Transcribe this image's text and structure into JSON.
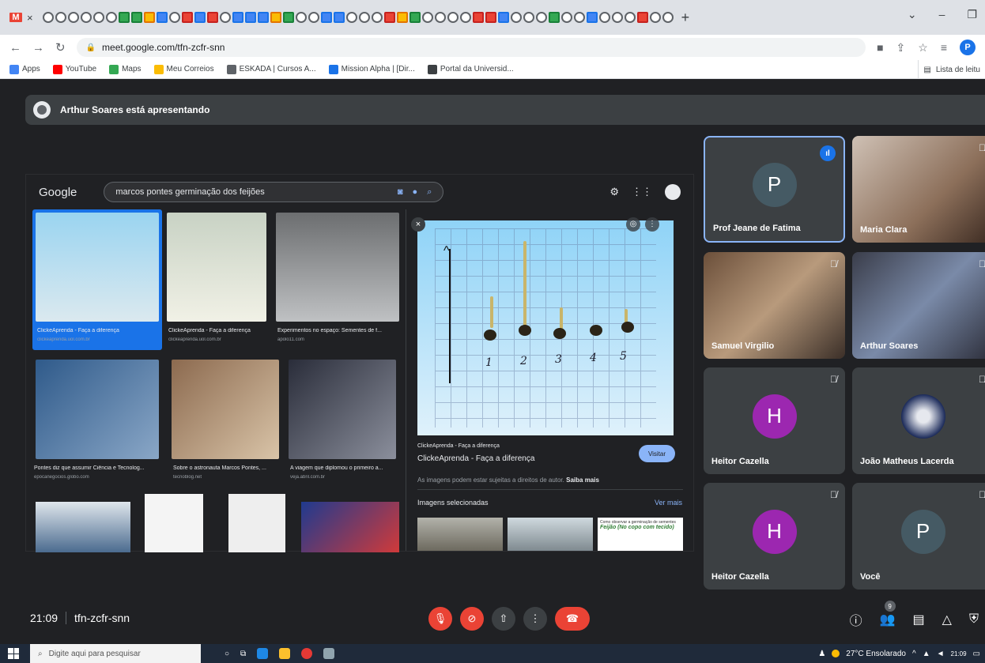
{
  "browser": {
    "url": "meet.google.com/tfn-zcfr-snn",
    "new_tab": "+",
    "bookmarks": [
      {
        "label": "Apps",
        "color": "#4285f4"
      },
      {
        "label": "YouTube",
        "color": "#ff0000"
      },
      {
        "label": "Maps",
        "color": "#34a853"
      },
      {
        "label": "Meu Correios",
        "color": "#fbbc04"
      },
      {
        "label": "ESKADA | Cursos A...",
        "color": "#5f6368"
      },
      {
        "label": "Mission Alpha | [Dir...",
        "color": "#1a73e8"
      },
      {
        "label": "Portal da Universid...",
        "color": "#3c4043"
      }
    ],
    "reading_list": "Lista de leitu"
  },
  "meet": {
    "presenter_banner": "Arthur Soares está apresentando",
    "time": "21:09",
    "meeting_code": "tfn-zcfr-snn",
    "participants_count": "9"
  },
  "shared_screen": {
    "search_query": "marcos pontes germinação dos feijões",
    "logo": "Google",
    "results": [
      {
        "caption": "ClickeAprenda - Faça a diferença",
        "source": "clickeaprenda.uol.com.br"
      },
      {
        "caption": "ClickeAprenda - Faça a diferença",
        "source": "clickeaprenda.uol.com.br"
      },
      {
        "caption": "Experimentos no espaço: Sementes de f...",
        "source": "apolo11.com"
      },
      {
        "caption": "Pontes diz que assumir Ciência e Tecnolog...",
        "source": "epocanegocios.globo.com"
      },
      {
        "caption": "Sobre o astronauta Marcos Pontes, ...",
        "source": "tecnoblog.net"
      },
      {
        "caption": "A viagem que diplomou o primeiro a...",
        "source": "veja.abril.com.br"
      }
    ],
    "preview": {
      "site": "ClickeAprenda - Faça a diferença",
      "title": "ClickeAprenda - Faça a diferença",
      "visit": "Visitar",
      "note": "As imagens podem estar sujeitas a direitos de autor.",
      "note_link": "Saiba mais",
      "selected_title": "Imagens selecionadas",
      "see_more": "Ver mais",
      "seed_numbers": [
        "1",
        "2",
        "3",
        "4",
        "5"
      ],
      "thumb_caption": "Como observar a germinação de sementes",
      "thumb_subcaption": "Feijão (No copo com tecido)"
    }
  },
  "tiles": [
    {
      "name": "Prof Jeane de Fatima",
      "initial": "P",
      "avatar_color": "#455a64",
      "speaking": true
    },
    {
      "name": "Maria Clara",
      "video": true
    },
    {
      "name": "Samuel Virgilio",
      "video": true
    },
    {
      "name": "Arthur Soares",
      "video": true
    },
    {
      "name": "Heitor Cazella",
      "initial": "H",
      "avatar_color": "#9c27b0"
    },
    {
      "name": "João Matheus Lacerda",
      "video": true
    },
    {
      "name": "Heitor Cazella",
      "initial": "H",
      "avatar_color": "#9c27b0"
    },
    {
      "name": "Você",
      "initial": "P",
      "avatar_color": "#455a64"
    }
  ],
  "taskbar": {
    "search_placeholder": "Digite aqui para pesquisar",
    "weather": "27°C Ensolarado",
    "clock_time": "21:09"
  }
}
